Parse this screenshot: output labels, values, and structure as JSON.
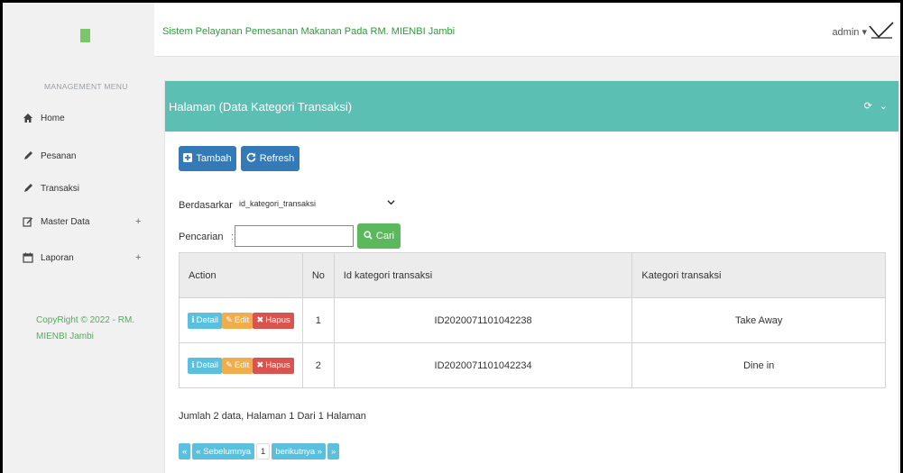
{
  "sidebar": {
    "heading": "MANAGEMENT MENU",
    "items": [
      {
        "label": "Home",
        "icon": "home-icon",
        "has_plus": false
      },
      {
        "label": "Pesanan",
        "icon": "pencil-icon",
        "has_plus": false
      },
      {
        "label": "Transaksi",
        "icon": "pencil-icon",
        "has_plus": false
      },
      {
        "label": "Master Data",
        "icon": "edit-icon",
        "has_plus": true
      },
      {
        "label": "Laporan",
        "icon": "calendar-icon",
        "has_plus": true
      }
    ],
    "plus": "+",
    "copyright": "CopyRight © 2022 - RM. MIENBI Jambi"
  },
  "header": {
    "title": "Sistem Pelayanan Pemesanan Makanan Pada RM. MIENBI Jambi",
    "user": "admin",
    "user_caret": "▾"
  },
  "panel": {
    "title": "Halaman (Data Kategori Transaksi)",
    "tools": {
      "refresh": "⟳",
      "collapse": "⌄"
    }
  },
  "toolbar": {
    "add_label": "Tambah",
    "refresh_label": "Refresh"
  },
  "search": {
    "by_label": "Berdasarkan:",
    "by_value": "id_kategori_transaksi",
    "query_label": "Pencarian",
    "query_sep": ":",
    "query_value": "",
    "search_button": "Cari"
  },
  "table": {
    "headers": [
      "Action",
      "No",
      "Id kategori transaksi",
      "Kategori transaksi"
    ],
    "actions": {
      "detail": "Detail",
      "edit": "Edit",
      "delete": "Hapus"
    },
    "rows": [
      {
        "no": "1",
        "id": "ID2020071101042238",
        "kategori": "Take Away"
      },
      {
        "no": "2",
        "id": "ID2020071101042234",
        "kategori": "Dine in"
      }
    ]
  },
  "summary": "Jumlah 2 data, Halaman 1 Dari 1 Halaman",
  "pagination": {
    "first": "«",
    "prev": "« Sebelumnya",
    "current": "1",
    "next": "berikutnya »",
    "last": "»"
  },
  "colors": {
    "panel_header": "#5bbfb4",
    "primary": "#337ab7",
    "success": "#5cb85c",
    "info": "#5bc0de",
    "warning": "#f0ad4e",
    "danger": "#d9534f",
    "brand_green": "#2e9a3b"
  }
}
